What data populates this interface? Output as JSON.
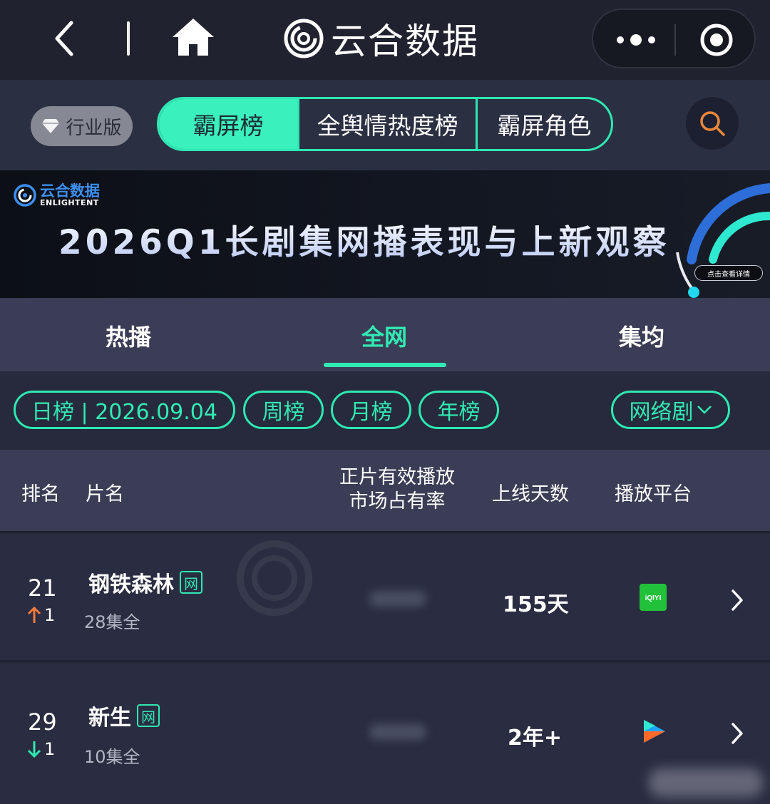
{
  "nav": {
    "app_title": "云合数据",
    "icons": [
      "back-icon",
      "home-icon",
      "more-icon",
      "close-icon"
    ]
  },
  "header": {
    "industry_label": "行业版",
    "segments": [
      "霸屏榜",
      "全舆情热度榜",
      "霸屏角色"
    ],
    "active_segment": "霸屏榜",
    "accent_color": "#2ee8b3"
  },
  "banner": {
    "logo_cn": "云合数据",
    "logo_en": "ENLIGHTENT",
    "headline": "2026Q1长剧集网播表现与上新观察",
    "cta": "点击查看详情"
  },
  "tabs": {
    "items": [
      "热播",
      "全网",
      "集均"
    ],
    "active": "全网"
  },
  "filters": {
    "daily": "日榜 | 2026.09.04",
    "weekly": "周榜",
    "monthly": "月榜",
    "yearly": "年榜",
    "genre": "网络剧"
  },
  "table": {
    "headers": {
      "rank": "排名",
      "name": "片名",
      "share_line1": "正片有效播放",
      "share_line2": "市场占有率",
      "days": "上线天数",
      "platform": "播放平台"
    },
    "rows": [
      {
        "rank": "21",
        "change": "1",
        "change_dir": "up",
        "title": "钢铁森林",
        "badge": "网",
        "episodes": "28集全",
        "days": "155天",
        "platform": "iqiyi-icon",
        "platform_text": "iQIYI"
      },
      {
        "rank": "29",
        "change": "1",
        "change_dir": "down",
        "title": "新生",
        "badge": "网",
        "episodes": "10集全",
        "days": "2年+",
        "platform": "youku-icon"
      }
    ]
  }
}
